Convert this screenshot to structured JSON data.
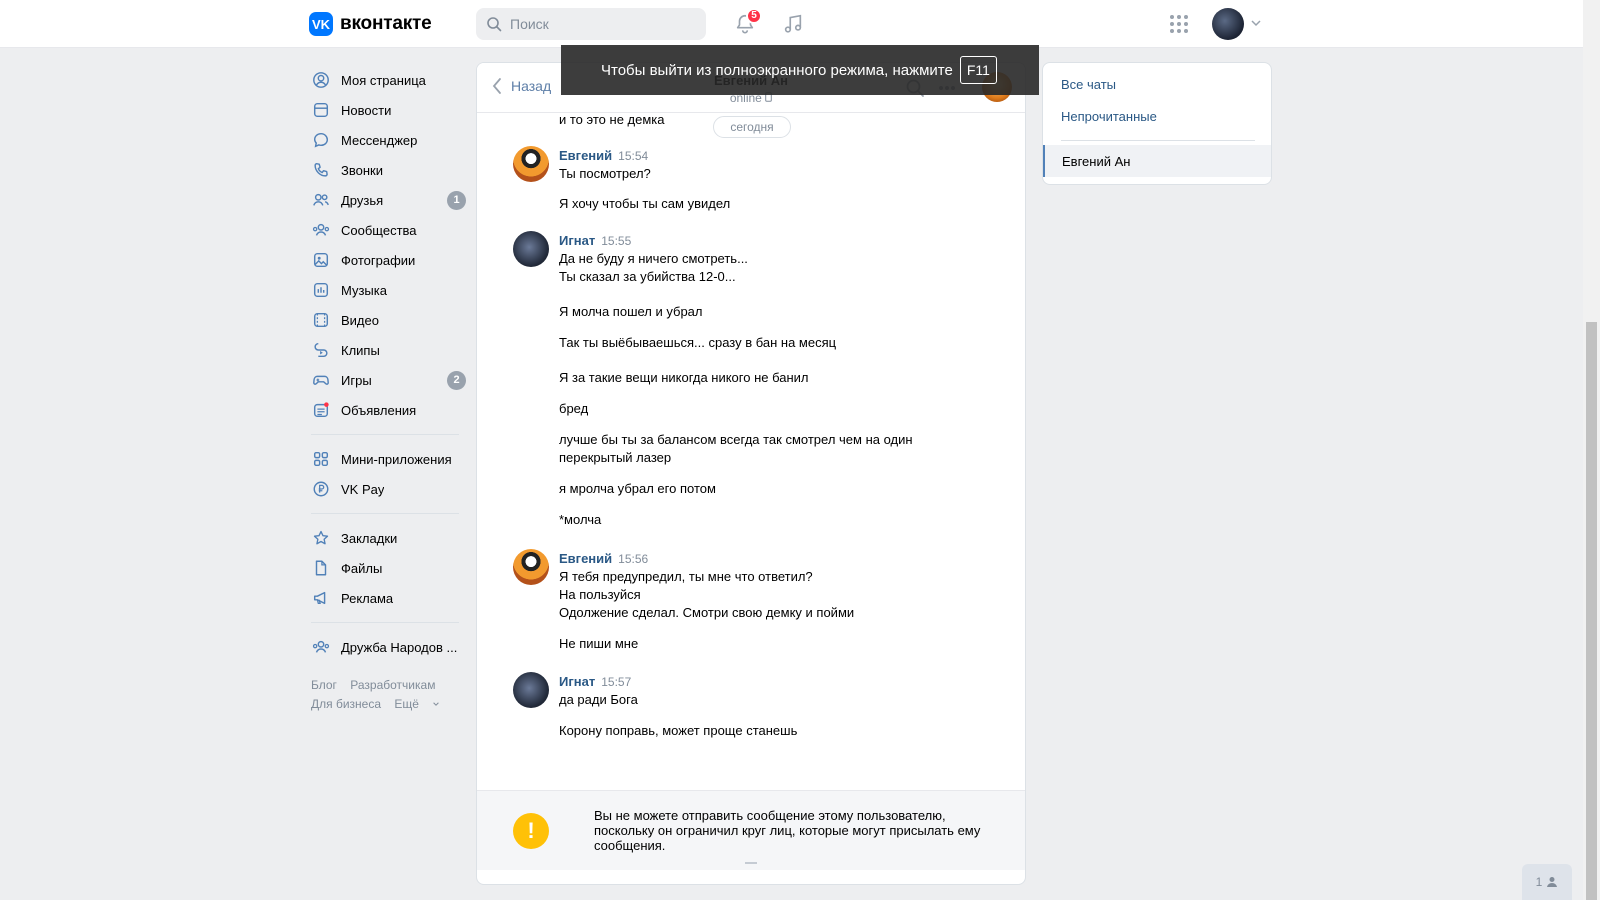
{
  "header": {
    "logo_text": "вконтакте",
    "logo_mark": "VK",
    "search_placeholder": "Поиск",
    "notifications_count": "5",
    "icons": [
      "bell-icon",
      "music-icon",
      "apps-grid-icon",
      "chevron-down-icon"
    ]
  },
  "sidebar": {
    "items": [
      {
        "label": "Моя страница",
        "icon": "user-circle-icon"
      },
      {
        "label": "Новости",
        "icon": "news-icon"
      },
      {
        "label": "Мессенджер",
        "icon": "message-icon"
      },
      {
        "label": "Звонки",
        "icon": "phone-icon"
      },
      {
        "label": "Друзья",
        "icon": "friends-icon",
        "badge": "1"
      },
      {
        "label": "Сообщества",
        "icon": "communities-icon"
      },
      {
        "label": "Фотографии",
        "icon": "photo-icon"
      },
      {
        "label": "Музыка",
        "icon": "music-icon"
      },
      {
        "label": "Видео",
        "icon": "video-icon"
      },
      {
        "label": "Клипы",
        "icon": "clips-icon"
      },
      {
        "label": "Игры",
        "icon": "gamepad-icon",
        "badge": "2"
      },
      {
        "label": "Объявления",
        "icon": "ads-icon"
      }
    ],
    "group2": [
      {
        "label": "Мини-приложения",
        "icon": "mini-apps-icon"
      },
      {
        "label": "VK Pay",
        "icon": "vkpay-icon"
      }
    ],
    "group3": [
      {
        "label": "Закладки",
        "icon": "star-icon"
      },
      {
        "label": "Файлы",
        "icon": "file-icon"
      },
      {
        "label": "Реклама",
        "icon": "megaphone-icon"
      }
    ],
    "group4": [
      {
        "label": "Дружба Народов ...",
        "icon": "group-icon"
      }
    ],
    "footer": {
      "blog": "Блог",
      "developers": "Разработчикам",
      "business": "Для бизнеса",
      "more": "Ещё"
    }
  },
  "chat": {
    "back_label": "Назад",
    "peer_name": "Евгений Ан",
    "peer_status": "online",
    "date_divider": "сегодня",
    "messages": {
      "m0": "и то это не демка",
      "g1_author": "Евгений",
      "g1_time": "15:54",
      "g1_l1": "Ты посмотрел?",
      "g1_l2": "Я хочу чтобы ты сам увидел",
      "g2_author": "Игнат",
      "g2_time": "15:55",
      "g2_l1": "Да не буду я ничего смотреть...",
      "g2_l2": "Ты сказал за убийства 12-0...",
      "g2_l3": "Я молча пошел и убрал",
      "g2_l4": "Так ты выёбываешься... сразу в бан на месяц",
      "g2_l5": "Я за такие вещи никогда никого не банил",
      "g2_l6": "бред",
      "g2_l7": "лучше бы ты за балансом всегда так смотрел чем на один",
      "g2_l8": "перекрытый лазер",
      "g2_l9": "я мролча убрал его потом",
      "g2_l10": "*молча",
      "g3_author": "Евгений",
      "g3_time": "15:56",
      "g3_l1": "Я тебя предупредил, ты мне что ответил?",
      "g3_l2": "На пользуйся",
      "g3_l3": "Одолжение сделал. Смотри свою демку и пойми",
      "g3_l4": "Не пиши мне",
      "g4_author": "Игнат",
      "g4_time": "15:57",
      "g4_l1": "да ради Бога",
      "g4_l2": "Корону поправь, может проще станешь"
    },
    "notice_symbol": "!",
    "notice": "Вы не можете отправить сообщение этому пользователю, поскольку он ограничил круг лиц, которые могут присылать ему сообщения."
  },
  "right_panel": {
    "all_chats": "Все чаты",
    "unread": "Непрочитанные",
    "active_chat": "Евгений Ан"
  },
  "fullscreen_toast": {
    "text": "Чтобы выйти из полноэкранного режима, нажмите",
    "key": "F11"
  },
  "corner_button": {
    "count": "1"
  }
}
